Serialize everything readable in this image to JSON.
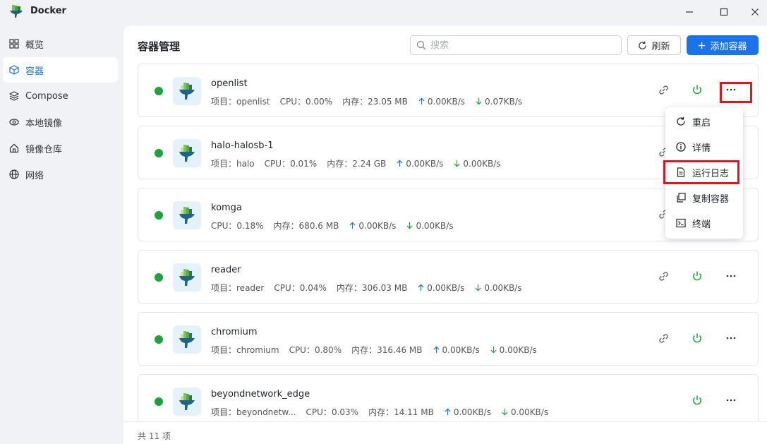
{
  "window": {
    "title": "Docker"
  },
  "sidebar": {
    "items": [
      {
        "label": "概览",
        "icon": "grid-icon"
      },
      {
        "label": "容器",
        "icon": "cube-icon",
        "active": true
      },
      {
        "label": "Compose",
        "icon": "layers-icon"
      },
      {
        "label": "本地镜像",
        "icon": "eye-icon"
      },
      {
        "label": "镜像仓库",
        "icon": "house-icon"
      },
      {
        "label": "网络",
        "icon": "globe-icon"
      }
    ]
  },
  "header": {
    "title": "容器管理",
    "search_placeholder": "搜索",
    "refresh_label": "刷新",
    "add_label": "添加容器"
  },
  "labels": {
    "project": "项目：",
    "cpu": "CPU：",
    "memory": "内存："
  },
  "containers": [
    {
      "name": "openlist",
      "project": "openlist",
      "cpu": "0.00%",
      "memory": "23.05 MB",
      "up": "0.00KB/s",
      "down": "0.07KB/s"
    },
    {
      "name": "halo-halosb-1",
      "project": "halo",
      "cpu": "0.01%",
      "memory": "2.24 GB",
      "up": "0.00KB/s",
      "down": "0.00KB/s"
    },
    {
      "name": "komga",
      "project": "",
      "cpu": "0.18%",
      "memory": "680.6 MB",
      "up": "0.00KB/s",
      "down": "0.00KB/s"
    },
    {
      "name": "reader",
      "project": "reader",
      "cpu": "0.04%",
      "memory": "306.03 MB",
      "up": "0.00KB/s",
      "down": "0.00KB/s"
    },
    {
      "name": "chromium",
      "project": "chromium",
      "cpu": "0.80%",
      "memory": "316.46 MB",
      "up": "0.00KB/s",
      "down": "0.00KB/s"
    },
    {
      "name": "beyondnetwork_edge",
      "project": "beyondnetw...",
      "cpu": "0.03%",
      "memory": "14.11 MB",
      "up": "0.00KB/s",
      "down": "0.00KB/s"
    }
  ],
  "menu": {
    "items": [
      {
        "label": "重启",
        "icon": "restart-icon"
      },
      {
        "label": "详情",
        "icon": "info-icon"
      },
      {
        "label": "运行日志",
        "icon": "log-file-icon"
      },
      {
        "label": "复制容器",
        "icon": "copy-icon"
      },
      {
        "label": "终端",
        "icon": "terminal-icon"
      }
    ]
  },
  "footer": {
    "total_text": "共 11 项"
  },
  "colors": {
    "accent": "#1a73e8",
    "running": "#1aa33a",
    "highlight": "#e3151b"
  }
}
